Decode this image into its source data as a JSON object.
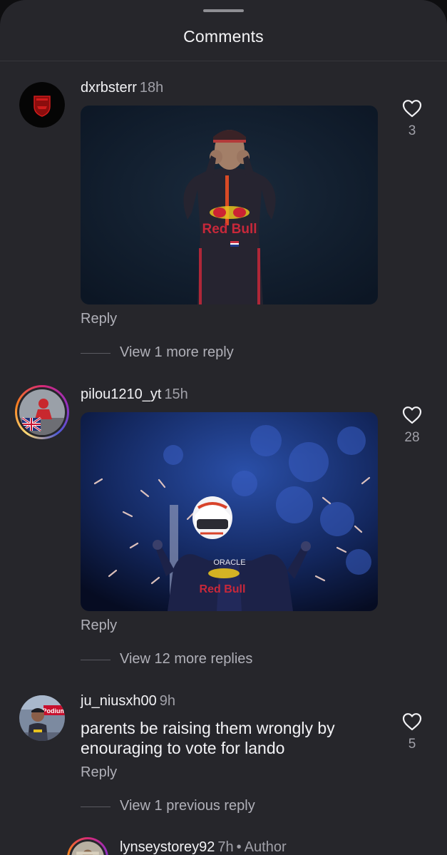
{
  "header": {
    "title": "Comments"
  },
  "comments": [
    {
      "username": "dxrbsterr",
      "time": "18h",
      "media": {
        "type": "gif",
        "jersey_text": "Red Bull"
      },
      "likes": "3",
      "reply_label": "Reply",
      "view_replies": "View 1 more reply"
    },
    {
      "username": "pilou1210_yt",
      "time": "15h",
      "media": {
        "type": "gif",
        "jersey_text": "Red Bull",
        "sponsor_text": "ORACLE"
      },
      "likes": "28",
      "reply_label": "Reply",
      "view_replies": "View 12 more replies"
    },
    {
      "username": "ju_niusxh00",
      "time": "9h",
      "text": "parents be raising them wrongly by enouraging to vote for lando",
      "likes": "5",
      "reply_label": "Reply",
      "view_replies": "View 1 previous reply"
    },
    {
      "username": "lynseystorey92",
      "time": "7h",
      "separator": "•",
      "badge": "Author"
    }
  ],
  "colors": {
    "background": "#26262b",
    "text_primary": "#f2f2f5",
    "text_secondary": "#a0a0a8"
  },
  "icons": [
    "heart-outline-icon"
  ]
}
